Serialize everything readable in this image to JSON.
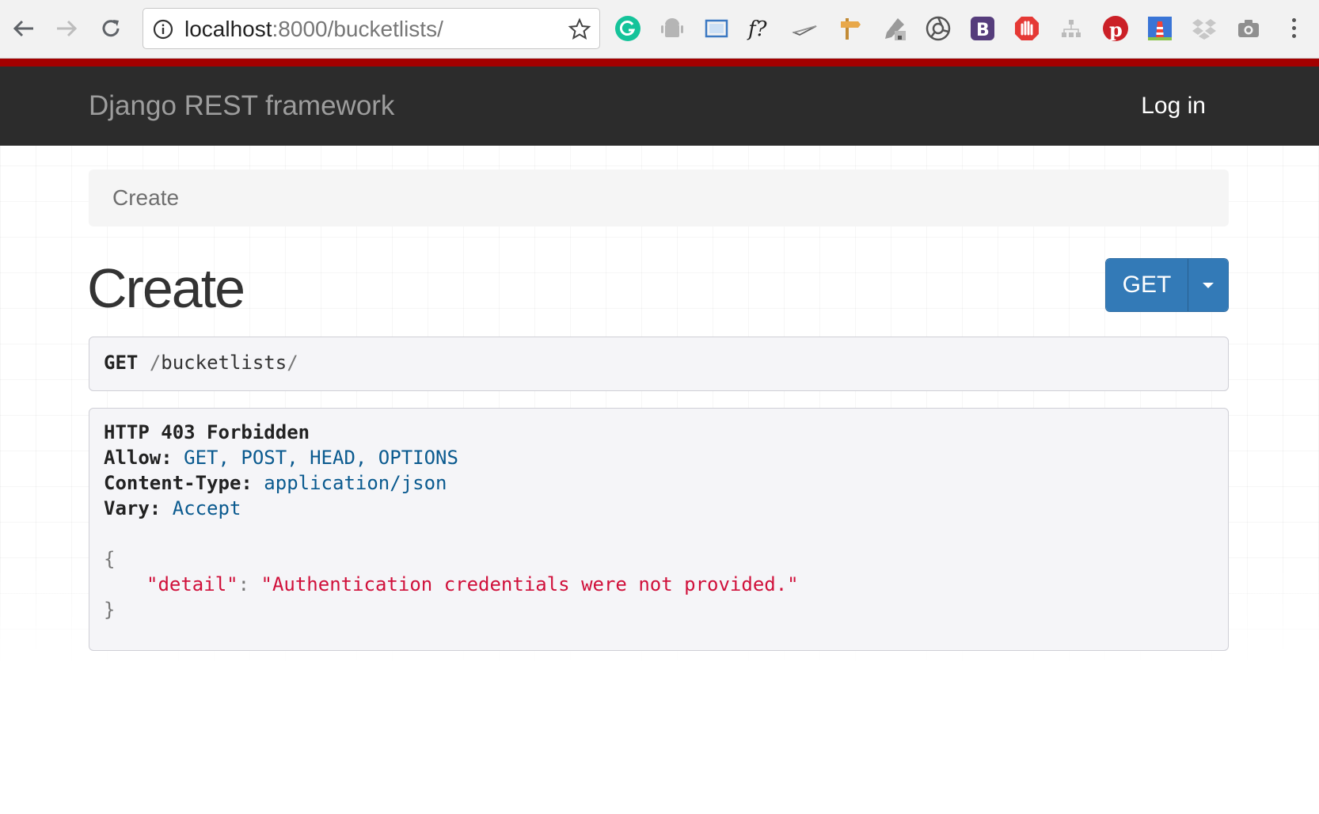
{
  "browser": {
    "url_host": "localhost",
    "url_rest": ":8000/bucketlists/",
    "extensions": [
      "grammarly-icon",
      "android-icon",
      "screenshot-frame-icon",
      "font-identifier-icon",
      "paper-plane-icon",
      "signpost-icon",
      "eyedropper-icon",
      "chrome-swirl-icon",
      "bootstrap-icon",
      "adblock-hand-icon",
      "sitemap-icon",
      "pinterest-icon",
      "lighthouse-icon",
      "dropbox-icon",
      "camera-icon"
    ]
  },
  "navbar": {
    "brand": "Django REST framework",
    "login": "Log in"
  },
  "breadcrumb": {
    "item": "Create"
  },
  "page": {
    "title": "Create"
  },
  "buttons": {
    "get": "GET"
  },
  "request": {
    "method": "GET",
    "slash": "/",
    "path": "bucketlists",
    "trailing_slash": "/"
  },
  "response": {
    "status": "HTTP 403 Forbidden",
    "headers": [
      {
        "name": "Allow:",
        "value": "GET, POST, HEAD, OPTIONS"
      },
      {
        "name": "Content-Type:",
        "value": "application/json"
      },
      {
        "name": "Vary:",
        "value": "Accept"
      }
    ],
    "body": {
      "open_brace": "{",
      "key": "\"detail\"",
      "colon": ":",
      "value": "\"Authentication credentials were not provided.\"",
      "close_brace": "}"
    }
  },
  "colors": {
    "accent_bar": "#a30000",
    "navbar_bg": "#2c2c2c",
    "button_primary": "#337ab7",
    "header_value": "#0a5a8f",
    "json_string": "#d0103a"
  }
}
